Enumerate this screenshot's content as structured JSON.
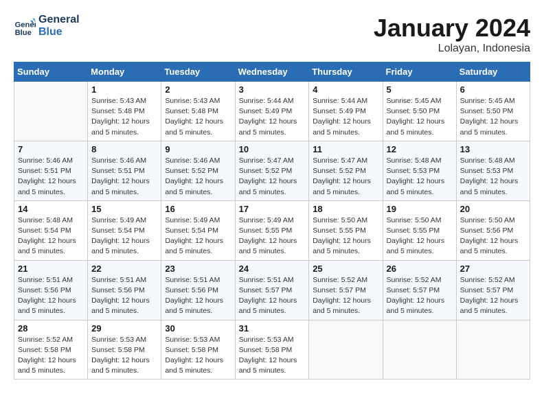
{
  "header": {
    "logo_line1": "General",
    "logo_line2": "Blue",
    "month": "January 2024",
    "location": "Lolayan, Indonesia"
  },
  "days_of_week": [
    "Sunday",
    "Monday",
    "Tuesday",
    "Wednesday",
    "Thursday",
    "Friday",
    "Saturday"
  ],
  "weeks": [
    [
      {
        "day": "",
        "info": ""
      },
      {
        "day": "1",
        "info": "Sunrise: 5:43 AM\nSunset: 5:48 PM\nDaylight: 12 hours\nand 5 minutes."
      },
      {
        "day": "2",
        "info": "Sunrise: 5:43 AM\nSunset: 5:48 PM\nDaylight: 12 hours\nand 5 minutes."
      },
      {
        "day": "3",
        "info": "Sunrise: 5:44 AM\nSunset: 5:49 PM\nDaylight: 12 hours\nand 5 minutes."
      },
      {
        "day": "4",
        "info": "Sunrise: 5:44 AM\nSunset: 5:49 PM\nDaylight: 12 hours\nand 5 minutes."
      },
      {
        "day": "5",
        "info": "Sunrise: 5:45 AM\nSunset: 5:50 PM\nDaylight: 12 hours\nand 5 minutes."
      },
      {
        "day": "6",
        "info": "Sunrise: 5:45 AM\nSunset: 5:50 PM\nDaylight: 12 hours\nand 5 minutes."
      }
    ],
    [
      {
        "day": "7",
        "info": "Sunrise: 5:46 AM\nSunset: 5:51 PM\nDaylight: 12 hours\nand 5 minutes."
      },
      {
        "day": "8",
        "info": "Sunrise: 5:46 AM\nSunset: 5:51 PM\nDaylight: 12 hours\nand 5 minutes."
      },
      {
        "day": "9",
        "info": "Sunrise: 5:46 AM\nSunset: 5:52 PM\nDaylight: 12 hours\nand 5 minutes."
      },
      {
        "day": "10",
        "info": "Sunrise: 5:47 AM\nSunset: 5:52 PM\nDaylight: 12 hours\nand 5 minutes."
      },
      {
        "day": "11",
        "info": "Sunrise: 5:47 AM\nSunset: 5:52 PM\nDaylight: 12 hours\nand 5 minutes."
      },
      {
        "day": "12",
        "info": "Sunrise: 5:48 AM\nSunset: 5:53 PM\nDaylight: 12 hours\nand 5 minutes."
      },
      {
        "day": "13",
        "info": "Sunrise: 5:48 AM\nSunset: 5:53 PM\nDaylight: 12 hours\nand 5 minutes."
      }
    ],
    [
      {
        "day": "14",
        "info": "Sunrise: 5:48 AM\nSunset: 5:54 PM\nDaylight: 12 hours\nand 5 minutes."
      },
      {
        "day": "15",
        "info": "Sunrise: 5:49 AM\nSunset: 5:54 PM\nDaylight: 12 hours\nand 5 minutes."
      },
      {
        "day": "16",
        "info": "Sunrise: 5:49 AM\nSunset: 5:54 PM\nDaylight: 12 hours\nand 5 minutes."
      },
      {
        "day": "17",
        "info": "Sunrise: 5:49 AM\nSunset: 5:55 PM\nDaylight: 12 hours\nand 5 minutes."
      },
      {
        "day": "18",
        "info": "Sunrise: 5:50 AM\nSunset: 5:55 PM\nDaylight: 12 hours\nand 5 minutes."
      },
      {
        "day": "19",
        "info": "Sunrise: 5:50 AM\nSunset: 5:55 PM\nDaylight: 12 hours\nand 5 minutes."
      },
      {
        "day": "20",
        "info": "Sunrise: 5:50 AM\nSunset: 5:56 PM\nDaylight: 12 hours\nand 5 minutes."
      }
    ],
    [
      {
        "day": "21",
        "info": "Sunrise: 5:51 AM\nSunset: 5:56 PM\nDaylight: 12 hours\nand 5 minutes."
      },
      {
        "day": "22",
        "info": "Sunrise: 5:51 AM\nSunset: 5:56 PM\nDaylight: 12 hours\nand 5 minutes."
      },
      {
        "day": "23",
        "info": "Sunrise: 5:51 AM\nSunset: 5:56 PM\nDaylight: 12 hours\nand 5 minutes."
      },
      {
        "day": "24",
        "info": "Sunrise: 5:51 AM\nSunset: 5:57 PM\nDaylight: 12 hours\nand 5 minutes."
      },
      {
        "day": "25",
        "info": "Sunrise: 5:52 AM\nSunset: 5:57 PM\nDaylight: 12 hours\nand 5 minutes."
      },
      {
        "day": "26",
        "info": "Sunrise: 5:52 AM\nSunset: 5:57 PM\nDaylight: 12 hours\nand 5 minutes."
      },
      {
        "day": "27",
        "info": "Sunrise: 5:52 AM\nSunset: 5:57 PM\nDaylight: 12 hours\nand 5 minutes."
      }
    ],
    [
      {
        "day": "28",
        "info": "Sunrise: 5:52 AM\nSunset: 5:58 PM\nDaylight: 12 hours\nand 5 minutes."
      },
      {
        "day": "29",
        "info": "Sunrise: 5:53 AM\nSunset: 5:58 PM\nDaylight: 12 hours\nand 5 minutes."
      },
      {
        "day": "30",
        "info": "Sunrise: 5:53 AM\nSunset: 5:58 PM\nDaylight: 12 hours\nand 5 minutes."
      },
      {
        "day": "31",
        "info": "Sunrise: 5:53 AM\nSunset: 5:58 PM\nDaylight: 12 hours\nand 5 minutes."
      },
      {
        "day": "",
        "info": ""
      },
      {
        "day": "",
        "info": ""
      },
      {
        "day": "",
        "info": ""
      }
    ]
  ]
}
